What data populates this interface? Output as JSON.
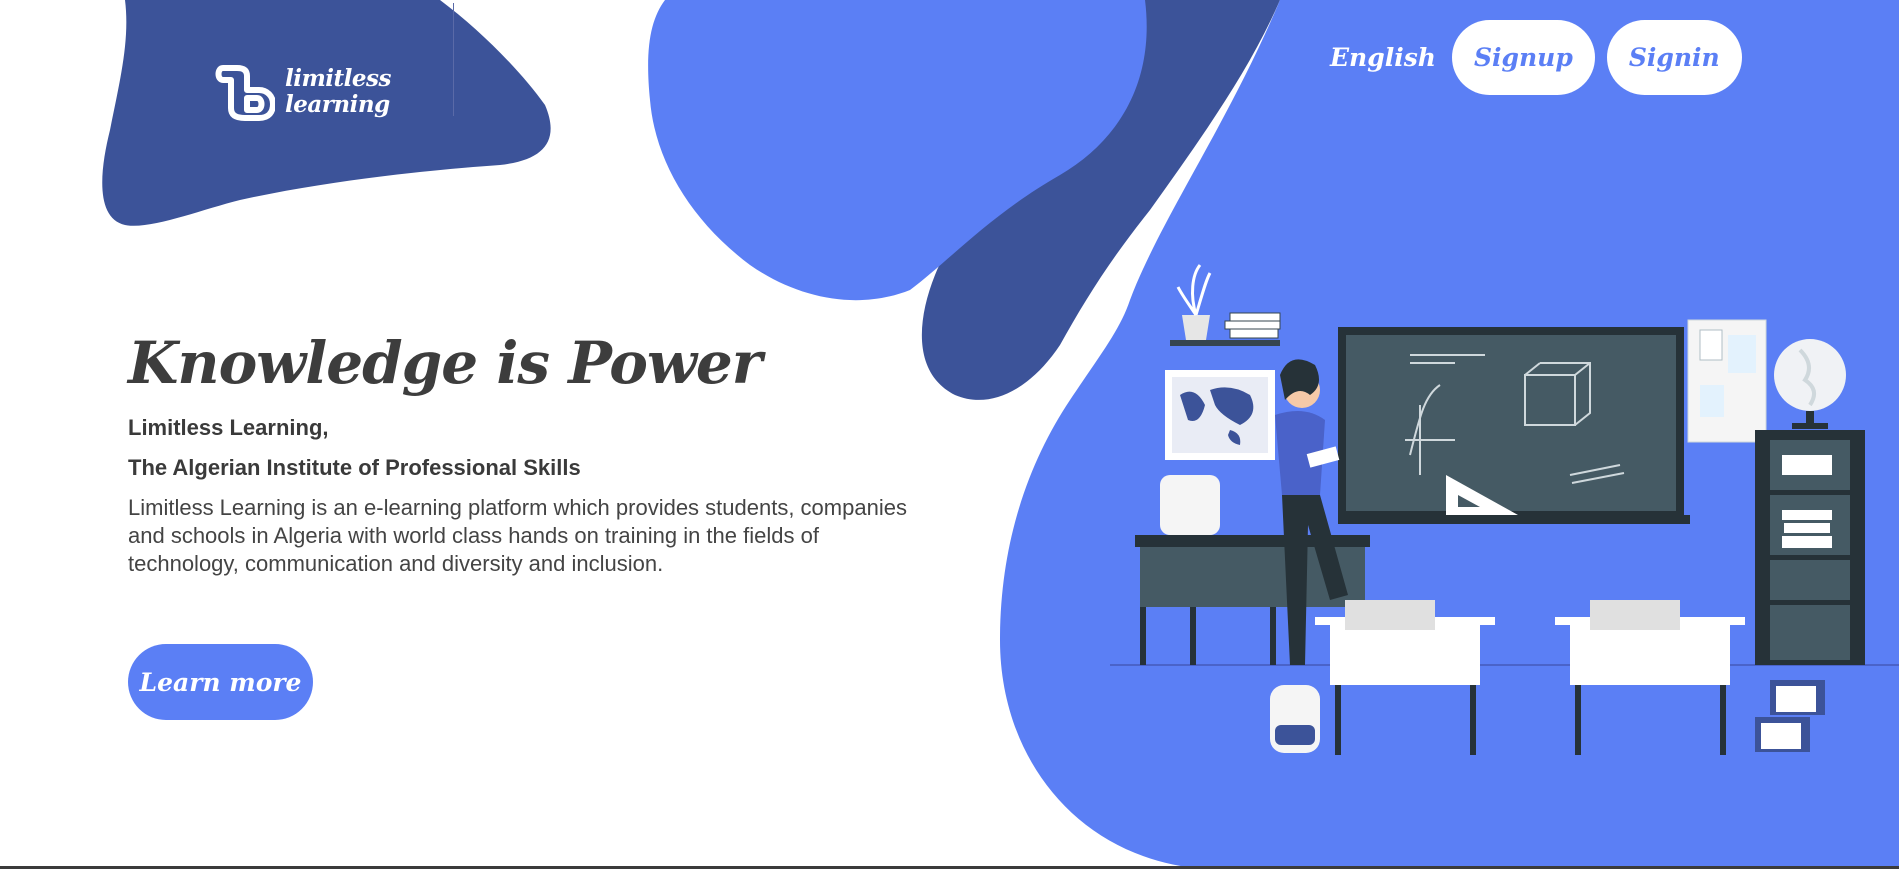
{
  "colors": {
    "primary": "#5b7ff5",
    "dark_blue": "#3c5399",
    "heading": "#3d3d3d",
    "white": "#ffffff"
  },
  "logo": {
    "line1": "limitless",
    "line2": "learning"
  },
  "nav": {
    "language": "English",
    "signup": "Signup",
    "signin": "Signin"
  },
  "hero": {
    "title": "Knowledge is Power",
    "subtitle_line1": "Limitless Learning,",
    "subtitle_line2": "The Algerian Institute of Professional Skills",
    "description": "Limitless Learning is an e-learning platform which provides students, companies and schools in Algeria with world class hands on training in the fields of technology, communication and diversity and inclusion.",
    "cta": "Learn more"
  },
  "illustration": {
    "icon": "classroom-teacher-illustration"
  }
}
